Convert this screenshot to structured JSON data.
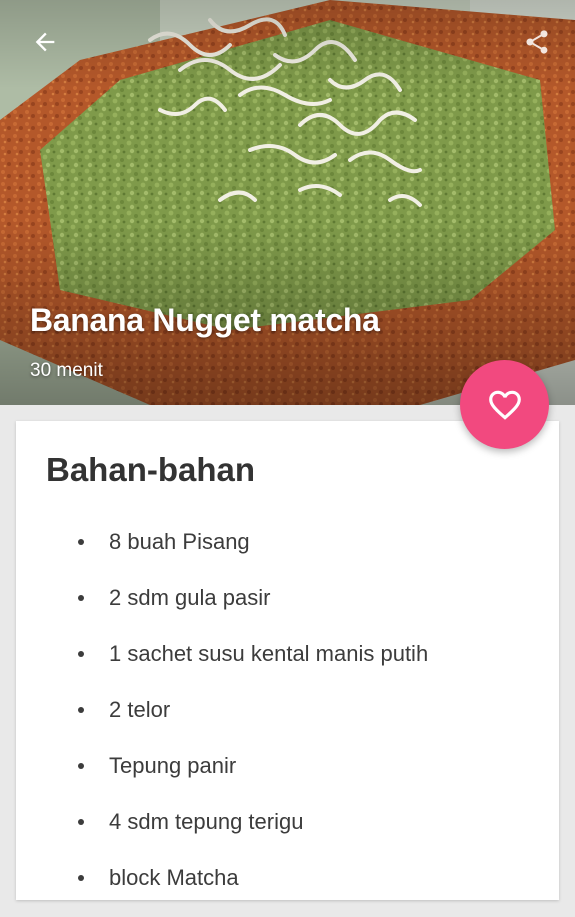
{
  "recipe": {
    "title": "Banana Nugget matcha",
    "duration": "30 menit"
  },
  "toolbar": {
    "back_icon": "arrow-left-icon",
    "share_icon": "share-icon"
  },
  "favorite": {
    "icon": "heart-outline-icon",
    "color": "#f2497f"
  },
  "ingredients": {
    "heading": "Bahan-bahan",
    "items": [
      "8 buah Pisang",
      "2 sdm gula pasir",
      "1 sachet susu kental manis putih",
      "2 telor",
      "Tepung panir",
      "4 sdm tepung terigu",
      "block Matcha"
    ]
  }
}
